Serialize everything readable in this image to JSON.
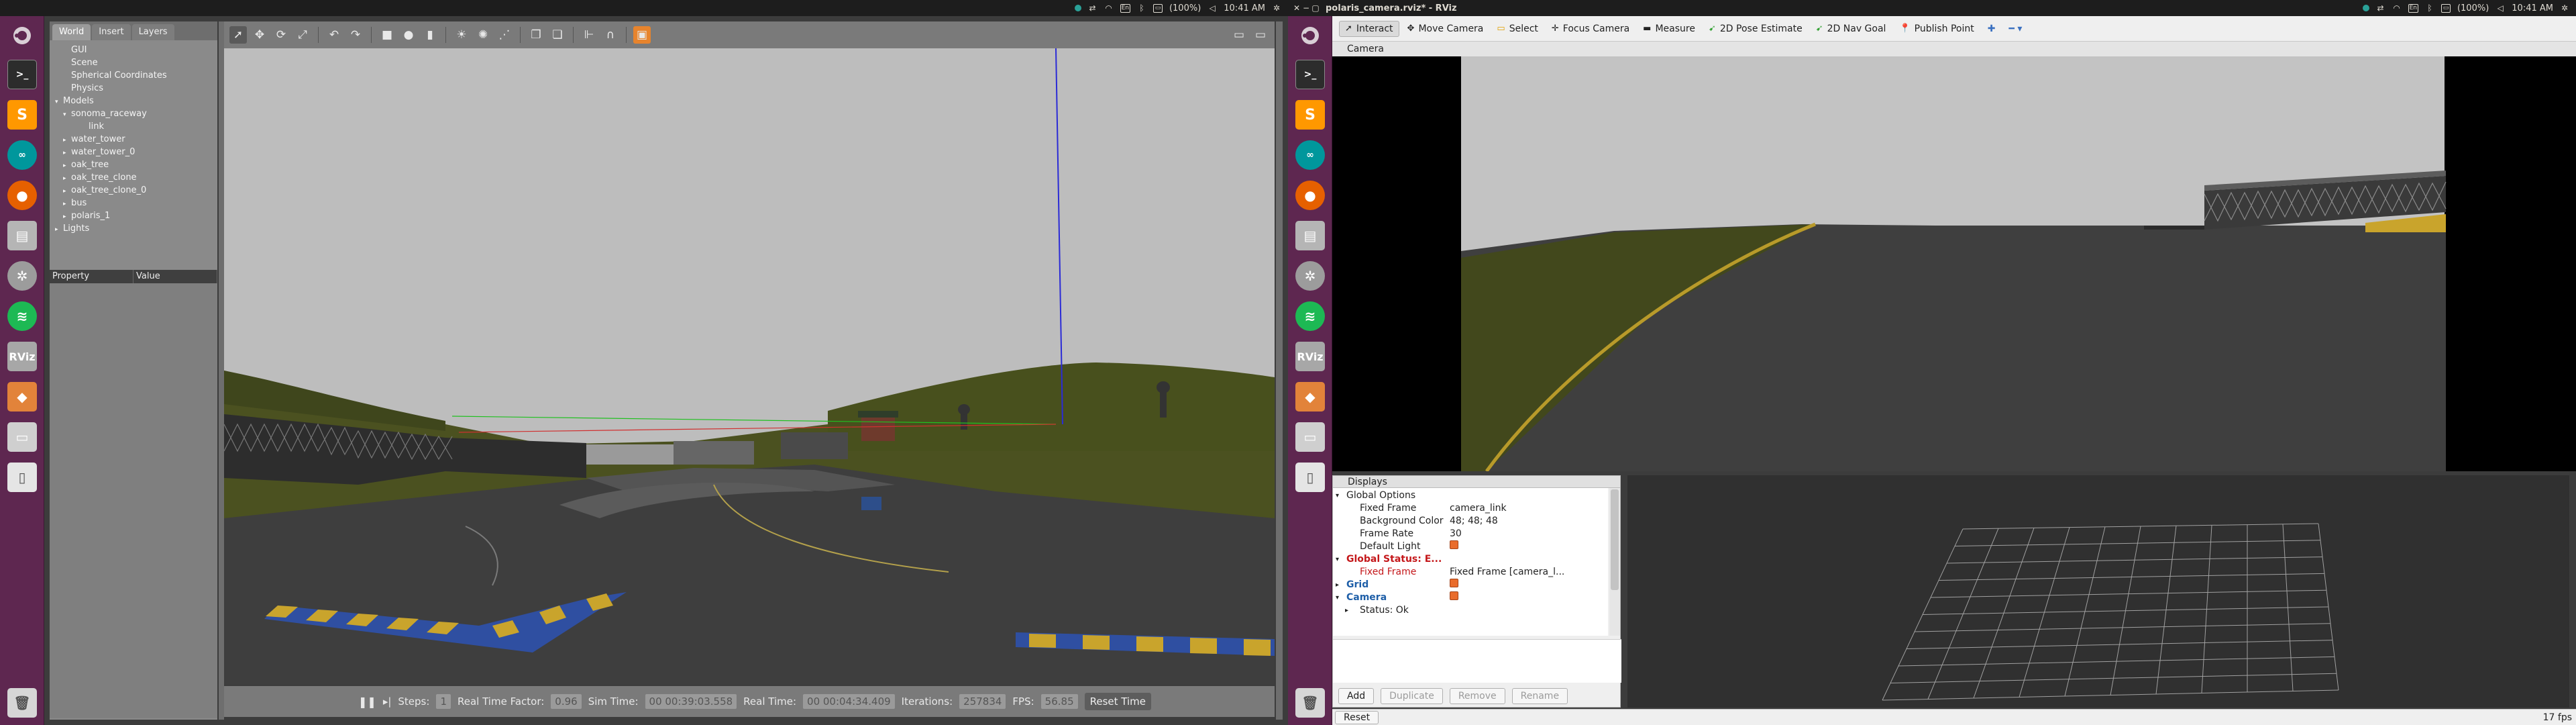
{
  "left_screen": {
    "panel": {
      "title": "",
      "battery": "(100%)",
      "time": "10:41 AM"
    },
    "gazebo": {
      "tabs": [
        "World",
        "Insert",
        "Layers"
      ],
      "tree": [
        {
          "label": "GUI",
          "level": 1,
          "arrow": ""
        },
        {
          "label": "Scene",
          "level": 1,
          "arrow": ""
        },
        {
          "label": "Spherical Coordinates",
          "level": 1,
          "arrow": ""
        },
        {
          "label": "Physics",
          "level": 1,
          "arrow": ""
        },
        {
          "label": "Models",
          "level": 0,
          "arrow": "▾"
        },
        {
          "label": "sonoma_raceway",
          "level": 1,
          "arrow": "▾"
        },
        {
          "label": "link",
          "level": 2,
          "arrow": ""
        },
        {
          "label": "water_tower",
          "level": 1,
          "arrow": "▸"
        },
        {
          "label": "water_tower_0",
          "level": 1,
          "arrow": "▸"
        },
        {
          "label": "oak_tree",
          "level": 1,
          "arrow": "▸"
        },
        {
          "label": "oak_tree_clone",
          "level": 1,
          "arrow": "▸"
        },
        {
          "label": "oak_tree_clone_0",
          "level": 1,
          "arrow": "▸"
        },
        {
          "label": "bus",
          "level": 1,
          "arrow": "▸"
        },
        {
          "label": "polaris_1",
          "level": 1,
          "arrow": "▸"
        },
        {
          "label": "Lights",
          "level": 0,
          "arrow": "▸"
        }
      ],
      "property_header": [
        "Property",
        "Value"
      ],
      "bottom": {
        "steps_label": "Steps:",
        "steps_value": "1",
        "rtf_label": "Real Time Factor:",
        "rtf_value": "0.96",
        "sim_label": "Sim Time:",
        "sim_value": "00 00:39:03.558",
        "real_label": "Real Time:",
        "real_value": "00 00:04:34.409",
        "iter_label": "Iterations:",
        "iter_value": "257834",
        "fps_label": "FPS:",
        "fps_value": "56.85",
        "reset_time": "Reset Time"
      }
    }
  },
  "right_screen": {
    "panel": {
      "title": "polaris_camera.rviz* - RViz",
      "battery": "(100%)",
      "time": "10:41 AM"
    },
    "rviz": {
      "tools": [
        {
          "label": "Interact",
          "icon": "interact-icon",
          "active": true
        },
        {
          "label": "Move Camera",
          "icon": "move-camera-icon",
          "active": false
        },
        {
          "label": "Select",
          "icon": "select-icon",
          "active": false
        },
        {
          "label": "Focus Camera",
          "icon": "focus-camera-icon",
          "active": false
        },
        {
          "label": "Measure",
          "icon": "measure-icon",
          "active": false
        },
        {
          "label": "2D Pose Estimate",
          "icon": "pose-estimate-icon",
          "active": false
        },
        {
          "label": "2D Nav Goal",
          "icon": "nav-goal-icon",
          "active": false
        },
        {
          "label": "Publish Point",
          "icon": "publish-point-icon",
          "active": false
        }
      ],
      "camera_panel_title": "Camera",
      "displays_title": "Displays",
      "displays": [
        {
          "key": "Global Options",
          "value": "",
          "level": 0,
          "arrow": "▾",
          "color": "#222222"
        },
        {
          "key": "Fixed Frame",
          "value": "camera_link",
          "level": 1,
          "arrow": "",
          "color": "#222222"
        },
        {
          "key": "Background Color",
          "value": "48; 48; 48",
          "level": 1,
          "arrow": "",
          "color": "#222222"
        },
        {
          "key": "Frame Rate",
          "value": "30",
          "level": 1,
          "arrow": "",
          "color": "#222222"
        },
        {
          "key": "Default Light",
          "value": "",
          "level": 1,
          "arrow": "",
          "color": "#222222",
          "check": true
        },
        {
          "key": "Global Status: E...",
          "value": "",
          "level": 0,
          "arrow": "▾",
          "color": "#c4171a"
        },
        {
          "key": "Fixed Frame",
          "value": "Fixed Frame [camera_l...",
          "level": 1,
          "arrow": "",
          "color": "#c4171a"
        },
        {
          "key": "Grid",
          "value": "",
          "level": 0,
          "arrow": "▸",
          "color": "#1f5fa8",
          "check": true
        },
        {
          "key": "Camera",
          "value": "",
          "level": 0,
          "arrow": "▾",
          "color": "#1f5fa8",
          "check": true
        },
        {
          "key": "Status: Ok",
          "value": "",
          "level": 1,
          "arrow": "▸",
          "color": "#222222"
        }
      ],
      "buttons": [
        "Add",
        "Duplicate",
        "Remove",
        "Rename"
      ],
      "reset": "Reset",
      "fps": "17 fps"
    }
  }
}
